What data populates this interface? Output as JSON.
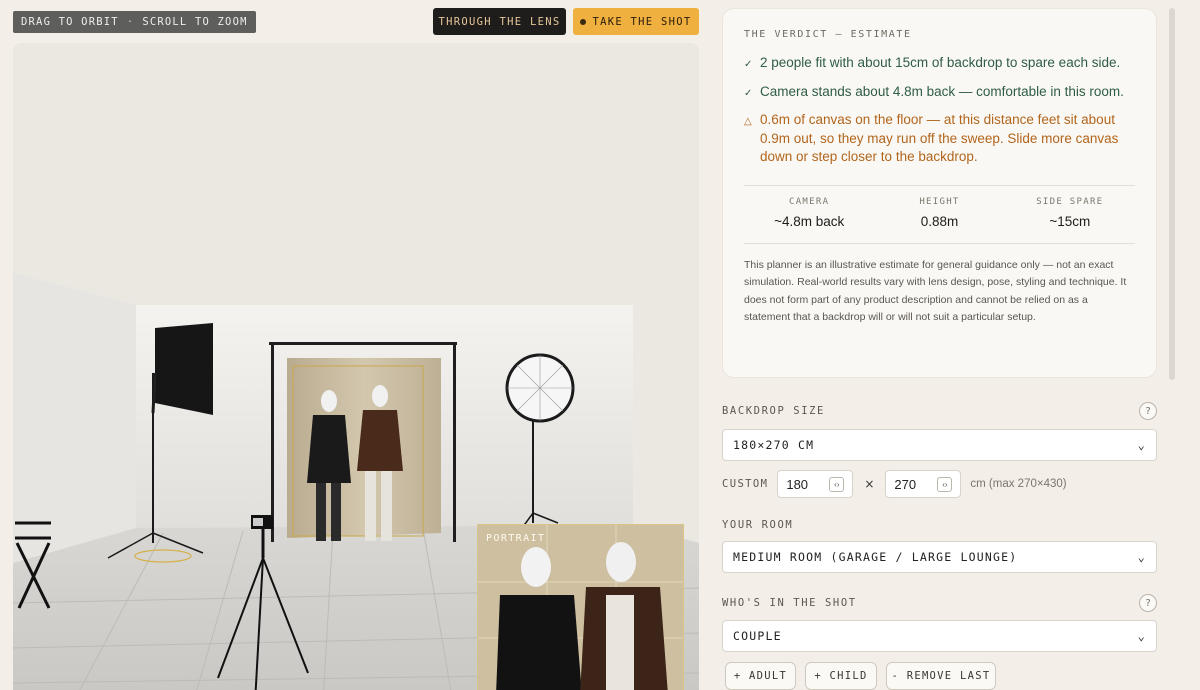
{
  "hint": {
    "drag": "DRAG TO ORBIT",
    "separator": "·",
    "scroll": "SCROLL TO ZOOM"
  },
  "toolbar": {
    "lens_label": "THROUGH THE LENS",
    "shot_label": "TAKE THE SHOT",
    "shot_icon": "record-dot-icon"
  },
  "preview": {
    "portrait_label": "PORTRAIT"
  },
  "verdict": {
    "heading": "THE VERDICT — ESTIMATE",
    "items": [
      {
        "status": "ok",
        "icon": "check-icon",
        "mark": "✓",
        "text": "2 people fit with about 15cm of backdrop to spare each side."
      },
      {
        "status": "ok",
        "icon": "check-icon",
        "mark": "✓",
        "text": "Camera stands about 4.8m back — comfortable in this room."
      },
      {
        "status": "warn",
        "icon": "warning-triangle-icon",
        "mark": "△",
        "text": "0.6m of canvas on the floor — at this distance feet sit about 0.9m out, so they may run off the sweep. Slide more canvas down or step closer to the backdrop."
      }
    ],
    "stats": [
      {
        "label": "CAMERA",
        "value": "~4.8m back"
      },
      {
        "label": "HEIGHT",
        "value": "0.88m"
      },
      {
        "label": "SIDE SPARE",
        "value": "~15cm"
      }
    ],
    "disclaimer": "This planner is an illustrative estimate for general guidance only — not an exact simulation. Real-world results vary with lens design, pose, styling and technique. It does not form part of any product description and cannot be relied on as a statement that a backdrop will or will not suit a particular setup."
  },
  "form": {
    "backdrop_size": {
      "label": "BACKDROP SIZE",
      "help": "?",
      "value": "180×270 CM"
    },
    "custom": {
      "label": "CUSTOM",
      "width": "180",
      "height": "270",
      "times": "×",
      "spin_icon": "‹›",
      "max_note": "cm (max 270×430)"
    },
    "room": {
      "label": "YOUR ROOM",
      "value": "MEDIUM ROOM (GARAGE / LARGE LOUNGE)"
    },
    "who": {
      "label": "WHO'S IN THE SHOT",
      "help": "?",
      "value": "COUPLE"
    },
    "buttons": {
      "add_adult": "+ ADULT",
      "add_child": "+ CHILD",
      "remove_last": "- REMOVE LAST"
    }
  },
  "colors": {
    "accent": "#f0b040",
    "dark": "#1f1d1b",
    "ok": "#2f5d44",
    "warn": "#b2651c",
    "panel": "#faf8f4"
  }
}
